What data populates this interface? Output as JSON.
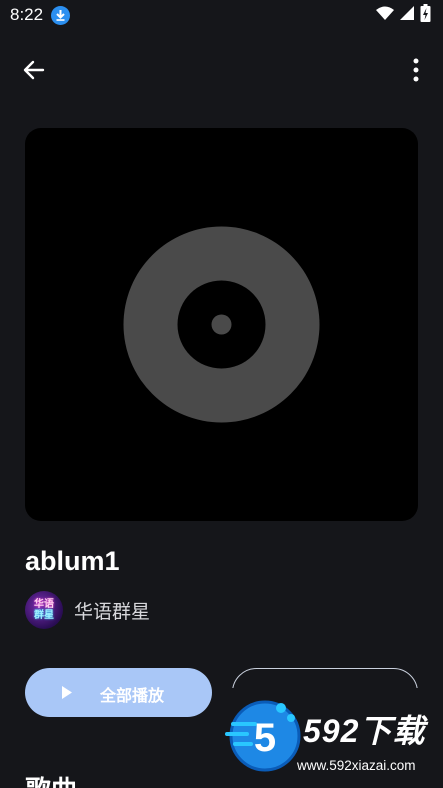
{
  "status_bar": {
    "time": "8:22",
    "icons": [
      "download-icon",
      "wifi-icon",
      "signal-icon",
      "battery-icon"
    ]
  },
  "app_bar": {
    "back_icon": "arrow-left-icon",
    "more_icon": "more-vertical-icon"
  },
  "album": {
    "title": "ablum1",
    "artist": "华语群星",
    "artist_avatar_text": [
      "华语",
      "群星"
    ],
    "cover_icon": "vinyl-disc-icon"
  },
  "actions": {
    "play_all_label": "全部播放",
    "play_icon": "play-icon",
    "secondary_label": ""
  },
  "section": {
    "title": "歌曲"
  },
  "watermark": {
    "brand": "592下载",
    "url": "www.592xiazai.com",
    "logo_digit": "5"
  },
  "colors": {
    "background": "#15161a",
    "primary_button": "#a9c7f7",
    "cover_background": "#000000",
    "disc": "#4a4a4a",
    "accent_blue": "#2b8ff0"
  }
}
